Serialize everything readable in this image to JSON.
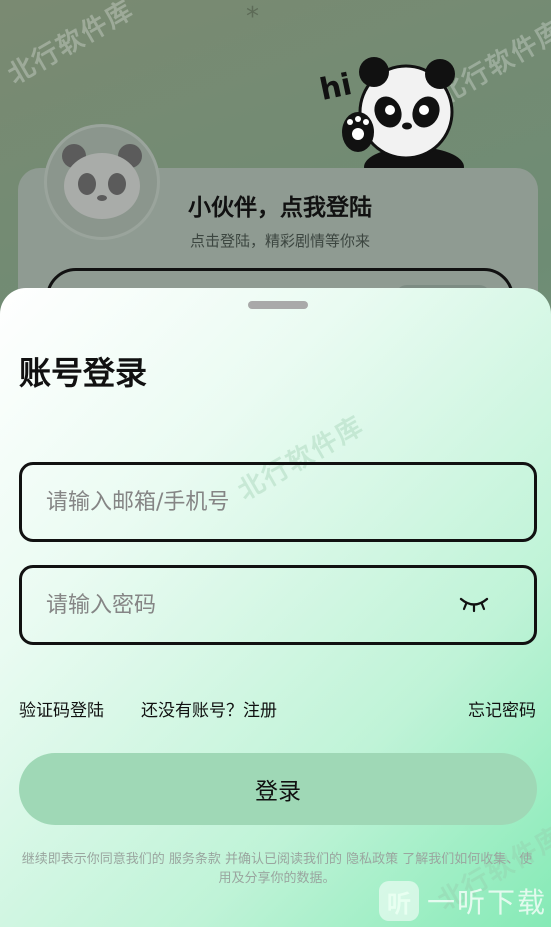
{
  "background": {
    "watermark": "北行软件库",
    "greeting": "hi",
    "card_title": "小伙伴，点我登陆",
    "card_subtitle": "点击登陆，精彩剧情等你来"
  },
  "sheet": {
    "title": "账号登录",
    "email_placeholder": "请输入邮箱/手机号",
    "password_placeholder": "请输入密码",
    "sms_login": "验证码登陆",
    "register": "还没有账号？注册",
    "forgot": "忘记密码",
    "login_button": "登录",
    "terms": "继续即表示你同意我们的 服务条款 并确认已阅读我们的 隐私政策 了解我们如何收集、使用及分享你的数据。",
    "brand_logo": "听",
    "brand_text": "一听下载"
  },
  "colors": {
    "accent": "#9fd8b6",
    "sheet_gradient_end": "#85eab6"
  },
  "icons": {
    "password_toggle": "eye-closed-icon"
  }
}
